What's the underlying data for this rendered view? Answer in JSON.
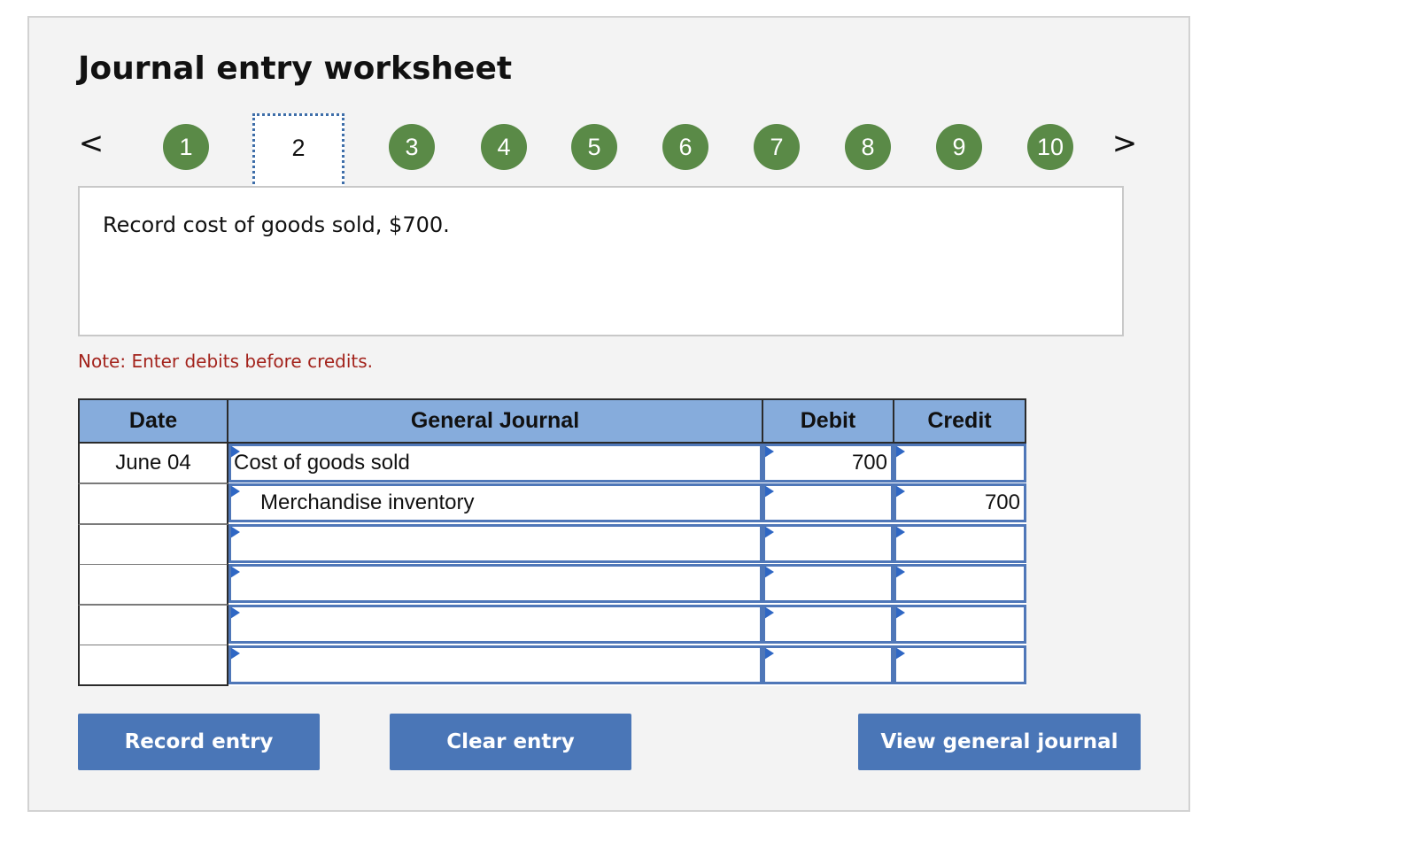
{
  "worksheet": {
    "title": "Journal entry worksheet",
    "nav": {
      "prev": "<",
      "next": ">",
      "steps": [
        "1",
        "2",
        "3",
        "4",
        "5",
        "6",
        "7",
        "8",
        "9",
        "10"
      ],
      "active_step": "2"
    },
    "instruction": "Record cost of goods sold, $700.",
    "note": "Note: Enter debits before credits."
  },
  "journal": {
    "headers": {
      "date": "Date",
      "account": "General Journal",
      "debit": "Debit",
      "credit": "Credit"
    },
    "rows": [
      {
        "date": "June 04",
        "account": "Cost of goods sold",
        "debit": "700",
        "credit": ""
      },
      {
        "date": "",
        "account": "Merchandise inventory",
        "debit": "",
        "credit": "700"
      },
      {
        "date": "",
        "account": "",
        "debit": "",
        "credit": ""
      },
      {
        "date": "",
        "account": "",
        "debit": "",
        "credit": ""
      },
      {
        "date": "",
        "account": "",
        "debit": "",
        "credit": ""
      },
      {
        "date": "",
        "account": "",
        "debit": "",
        "credit": ""
      }
    ]
  },
  "buttons": {
    "record": "Record entry",
    "clear": "Clear entry",
    "view": "View general journal"
  },
  "colors": {
    "step_green": "#5a8a47",
    "header_blue": "#86acdc",
    "button_blue": "#4a76b7",
    "note_red": "#a3231c",
    "field_border": "#4f77b8"
  }
}
